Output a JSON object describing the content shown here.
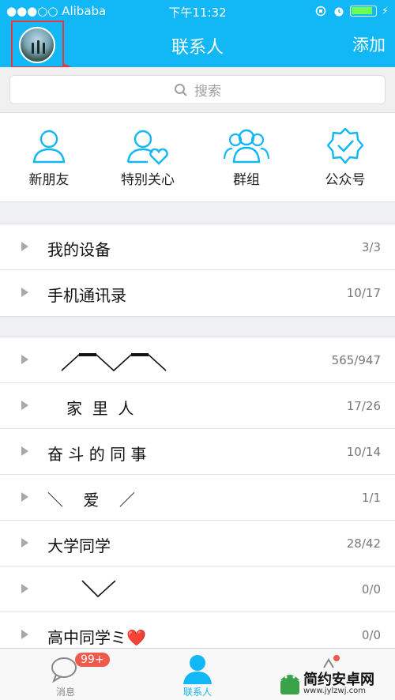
{
  "status": {
    "carrier": "●●●○○ Alibaba",
    "time": "下午11:32"
  },
  "header": {
    "title": "联系人",
    "add_label": "添加"
  },
  "search": {
    "placeholder": "搜索"
  },
  "quick": [
    {
      "label": "新朋友",
      "icon": "person-icon"
    },
    {
      "label": "特别关心",
      "icon": "person-heart-icon"
    },
    {
      "label": "群组",
      "icon": "group-icon"
    },
    {
      "label": "公众号",
      "icon": "verified-badge-icon"
    }
  ],
  "groups_a": [
    {
      "name": "我的设备",
      "count": "3/3"
    },
    {
      "name": "手机通讯录",
      "count": "10/17"
    }
  ],
  "groups_b": [
    {
      "name": "",
      "count": "565/947"
    },
    {
      "name": "家  里  人",
      "count": "17/26"
    },
    {
      "name": "奋 斗 的 同 事",
      "count": "10/14"
    },
    {
      "name": "＼    爱    ／",
      "count": "1/1"
    },
    {
      "name": "大学同学",
      "count": "28/42"
    },
    {
      "name": "",
      "count": "0/0"
    },
    {
      "name": "高中同学ミ❤️",
      "count": "0/0"
    }
  ],
  "tabs": [
    {
      "label": "消息"
    },
    {
      "label": "联系人"
    }
  ],
  "badge": "99+",
  "watermark": {
    "text": "简约安卓网",
    "url": "www.jylzwj.com"
  },
  "colors": {
    "accent": "#12b7f5",
    "highlight": "#e63a3a",
    "badge": "#f15a4a"
  }
}
